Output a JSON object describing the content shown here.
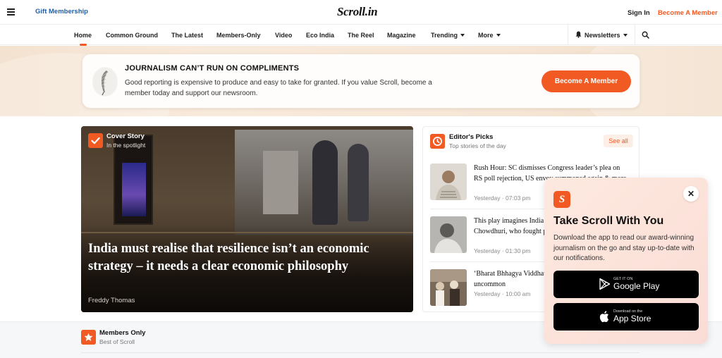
{
  "header": {
    "gift_label": "Gift Membership",
    "logo_text": "Scroll.in",
    "signin_label": "Sign In",
    "become_label": "Become A Member"
  },
  "nav": {
    "items": [
      "Home",
      "Common Ground",
      "The Latest",
      "Members-Only",
      "Video",
      "Eco India",
      "The Reel",
      "Magazine",
      "Trending",
      "More"
    ],
    "newsletters_label": "Newsletters",
    "active": "Home"
  },
  "banner": {
    "title": "JOURNALISM CAN’T RUN ON COMPLIMENTS",
    "text": "Good reporting is expensive to produce and easy to take for granted. If you value Scroll, become a member today and support our newsroom.",
    "button_label": "Become A Member"
  },
  "cover": {
    "label": "Cover Story",
    "sublabel": "In the spotlight",
    "headline": "India must realise that resilience isn’t an economic strategy – it needs a clear economic philosophy",
    "author": "Freddy Thomas"
  },
  "picks": {
    "title": "Editor's Picks",
    "subtitle": "Top stories of the day",
    "see_all_label": "See all",
    "items": [
      {
        "title": "Rush Hour: SC dismisses Congress leader’s plea on RS poll rejection, US envoy summoned again & more",
        "time": "Yesterday · 07:03 pm"
      },
      {
        "title": "This play imagines India’s first woman physicist Bibha Chowdhuri, who fought prejudices",
        "time": "Yesterday · 01:30 pm"
      },
      {
        "title": "‘Bharat Bhhagya Viddhata’ is an account of uncommon",
        "time": "Yesterday · 10:00 am"
      }
    ]
  },
  "members": {
    "title": "Members Only",
    "subtitle": "Best of Scroll"
  },
  "popup": {
    "logo_glyph": "S",
    "close_glyph": "✕",
    "title": "Take Scroll With You",
    "text": "Download the app to read our award-winning journalism on the go and stay up-to-date with our notifications.",
    "google_small": "GET IT ON",
    "google_big": "Google Play",
    "apple_small": "Download on the",
    "apple_big": "App Store"
  },
  "colors": {
    "accent": "#f15a22",
    "link_blue": "#1f5fa8"
  }
}
